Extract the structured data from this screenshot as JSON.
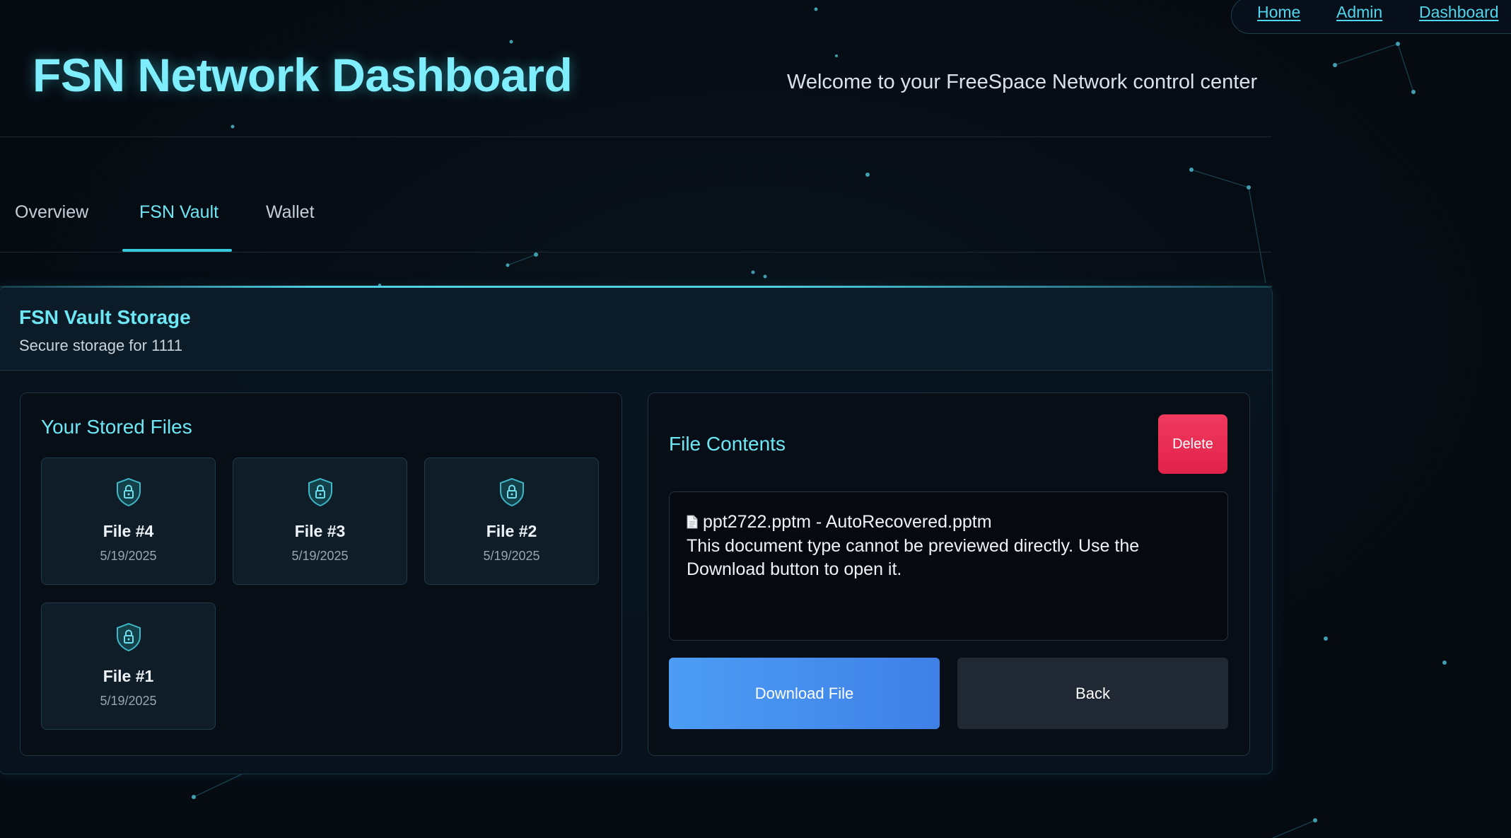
{
  "nav": {
    "links": [
      "Home",
      "Admin",
      "Dashboard"
    ]
  },
  "header": {
    "title": "FSN Network Dashboard",
    "welcome": "Welcome to your FreeSpace Network control center"
  },
  "tabs": [
    {
      "label": "Overview",
      "active": false
    },
    {
      "label": "FSN Vault",
      "active": true
    },
    {
      "label": "Wallet",
      "active": false
    }
  ],
  "vault": {
    "title": "FSN Vault Storage",
    "subtitle": "Secure storage for 1111",
    "files_title": "Your Stored Files",
    "files": [
      {
        "name": "File #4",
        "date": "5/19/2025",
        "icon": "shield-lock-icon"
      },
      {
        "name": "File #3",
        "date": "5/19/2025",
        "icon": "shield-lock-icon"
      },
      {
        "name": "File #2",
        "date": "5/19/2025",
        "icon": "shield-lock-icon"
      },
      {
        "name": "File #1",
        "date": "5/19/2025",
        "icon": "shield-lock-icon"
      }
    ],
    "contents": {
      "title": "File Contents",
      "delete_label": "Delete",
      "file_icon": "document-icon",
      "file_name": "ppt2722.pptm - AutoRecovered.pptm",
      "message": "This document type cannot be previewed directly. Use the Download button to open it.",
      "download_label": "Download File",
      "back_label": "Back"
    }
  },
  "colors": {
    "accent": "#6ee7f5",
    "background": "#060b12",
    "delete": "#e8294f",
    "download": "#4a92f0",
    "back": "#202834"
  }
}
